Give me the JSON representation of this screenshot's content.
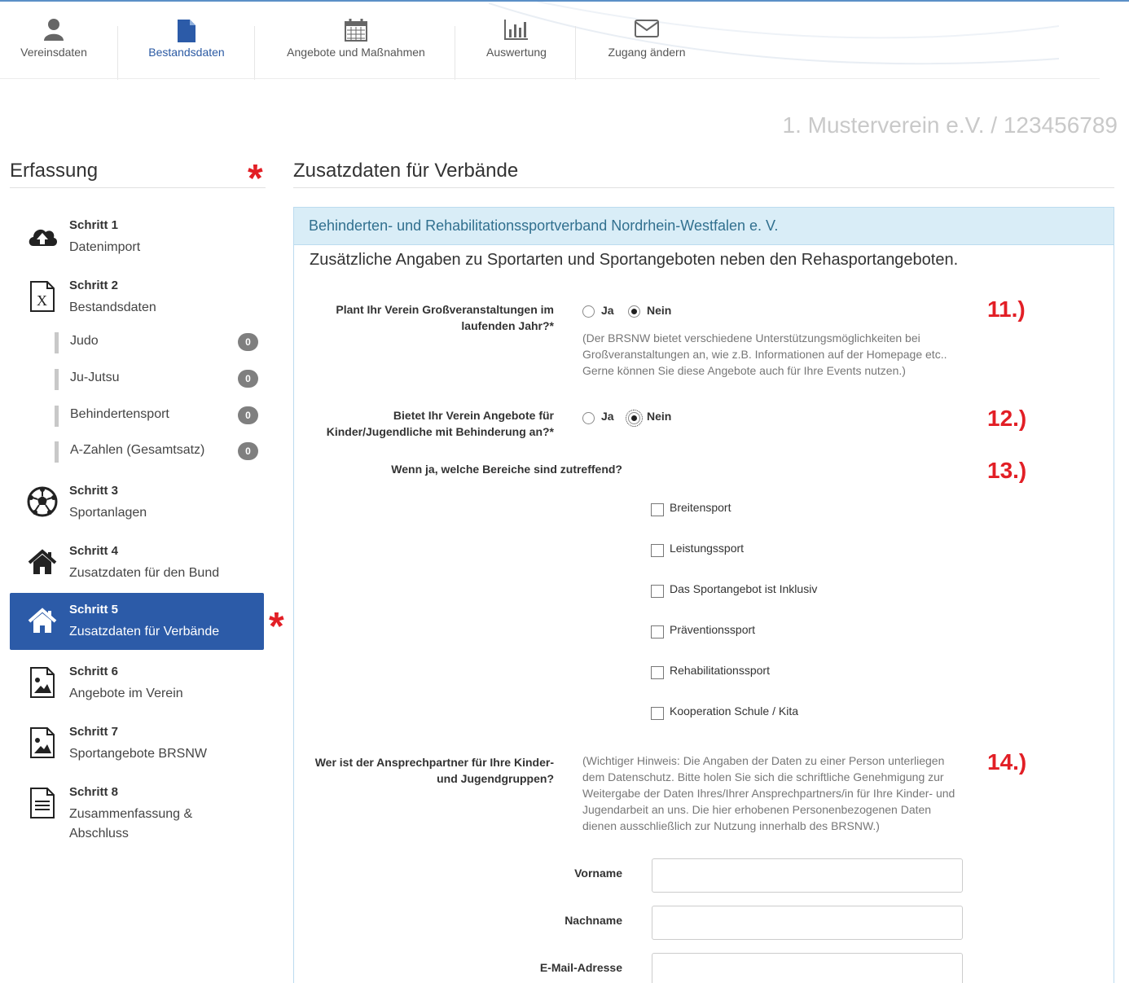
{
  "topnav": {
    "items": [
      {
        "label": "Vereinsdaten",
        "icon": "user-icon",
        "active": false
      },
      {
        "label": "Bestandsdaten",
        "icon": "document-icon",
        "active": true
      },
      {
        "label": "Angebote und Maßnahmen",
        "icon": "calendar-icon",
        "active": false
      },
      {
        "label": "Auswertung",
        "icon": "bar-chart-icon",
        "active": false
      },
      {
        "label": "Zugang ändern",
        "icon": "envelope-icon",
        "active": false
      }
    ]
  },
  "club_heading": "1. Musterverein e.V. / 123456789",
  "sidebar": {
    "title": "Erfassung",
    "steps": [
      {
        "title": "Schritt 1",
        "subtitle": "Datenimport",
        "icon": "cloud-upload-icon"
      },
      {
        "title": "Schritt 2",
        "subtitle": "Bestandsdaten",
        "icon": "excel-file-icon"
      },
      {
        "title": "Schritt 3",
        "subtitle": "Sportanlagen",
        "icon": "soccer-ball-icon"
      },
      {
        "title": "Schritt 4",
        "subtitle": "Zusatzdaten für den Bund",
        "icon": "home-icon"
      },
      {
        "title": "Schritt 5",
        "subtitle": "Zusatzdaten für Verbände",
        "icon": "home-icon",
        "active": true
      },
      {
        "title": "Schritt 6",
        "subtitle": "Angebote im Verein",
        "icon": "image-file-icon"
      },
      {
        "title": "Schritt 7",
        "subtitle": "Sportangebote BRSNW",
        "icon": "image-file-icon"
      },
      {
        "title": "Schritt 8",
        "subtitle": "Zusammenfassung &",
        "subtitle2": "Abschluss",
        "icon": "text-file-icon"
      }
    ],
    "subitems": [
      {
        "label": "Judo",
        "count": "0"
      },
      {
        "label": "Ju-Jutsu",
        "count": "0"
      },
      {
        "label": "Behindertensport",
        "count": "0"
      },
      {
        "label": "A-Zahlen (Gesamtsatz)",
        "count": "0"
      }
    ]
  },
  "main": {
    "title": "Zusatzdaten für Verbände",
    "panel_heading": "Behinderten- und Rehabilitationssportverband Nordrhein-Westfalen e. V.",
    "panel_subheading": "Zusätzliche Angaben zu Sportarten und Sportangeboten neben den Rehasportangeboten.",
    "q11": {
      "label_line1": "Plant Ihr Verein Großveranstaltungen im",
      "label_line2": "laufenden Jahr?*",
      "yes": "Ja",
      "no": "Nein",
      "selected": "Nein",
      "hint_line1": "(Der BRSNW bietet verschiedene Unterstützungsmöglichkeiten bei",
      "hint_line2": "Großveranstaltungen an, wie z.B. Informationen auf der Homepage etc..",
      "hint_line3": "Gerne können Sie diese Angebote auch für Ihre Events nutzen.)",
      "marker": "11.)"
    },
    "q12": {
      "label_line1": "Bietet Ihr Verein Angebote für",
      "label_line2": "Kinder/Jugendliche mit Behinderung an?*",
      "yes": "Ja",
      "no": "Nein",
      "selected": "Nein",
      "marker": "12.)"
    },
    "q13": {
      "label": "Wenn ja, welche Bereiche sind zutreffend?",
      "marker": "13.)",
      "options": [
        "Breitensport",
        "Leistungssport",
        "Das Sportangebot ist Inklusiv",
        "Präventionssport",
        "Rehabilitationssport",
        "Kooperation Schule / Kita"
      ]
    },
    "q14": {
      "label_line1": "Wer ist der Ansprechpartner für Ihre Kinder-",
      "label_line2": "und Jugendgruppen?",
      "marker": "14.)",
      "hint_line1": "(Wichtiger Hinweis: Die Angaben der Daten zu einer Person unterliegen",
      "hint_line2": "dem Datenschutz. Bitte holen Sie sich die schriftliche Genehmigung zur",
      "hint_line3": "Weitergabe der Daten Ihres/Ihrer Ansprechpartners/in für Ihre Kinder- und",
      "hint_line4": "Jugendarbeit an uns. Die hier erhobenen Personenbezogenen Daten",
      "hint_line5": "dienen ausschließlich zur Nutzung innerhalb des BRSNW.)",
      "fields": [
        {
          "label": "Vorname",
          "value": ""
        },
        {
          "label": "Nachname",
          "value": ""
        },
        {
          "label": "E-Mail-Adresse",
          "value": ""
        }
      ]
    }
  },
  "colors": {
    "primary": "#2c5ba8",
    "accent_red": "#e21f26",
    "panel_head": "#d9edf7",
    "panel_text": "#31708f"
  }
}
